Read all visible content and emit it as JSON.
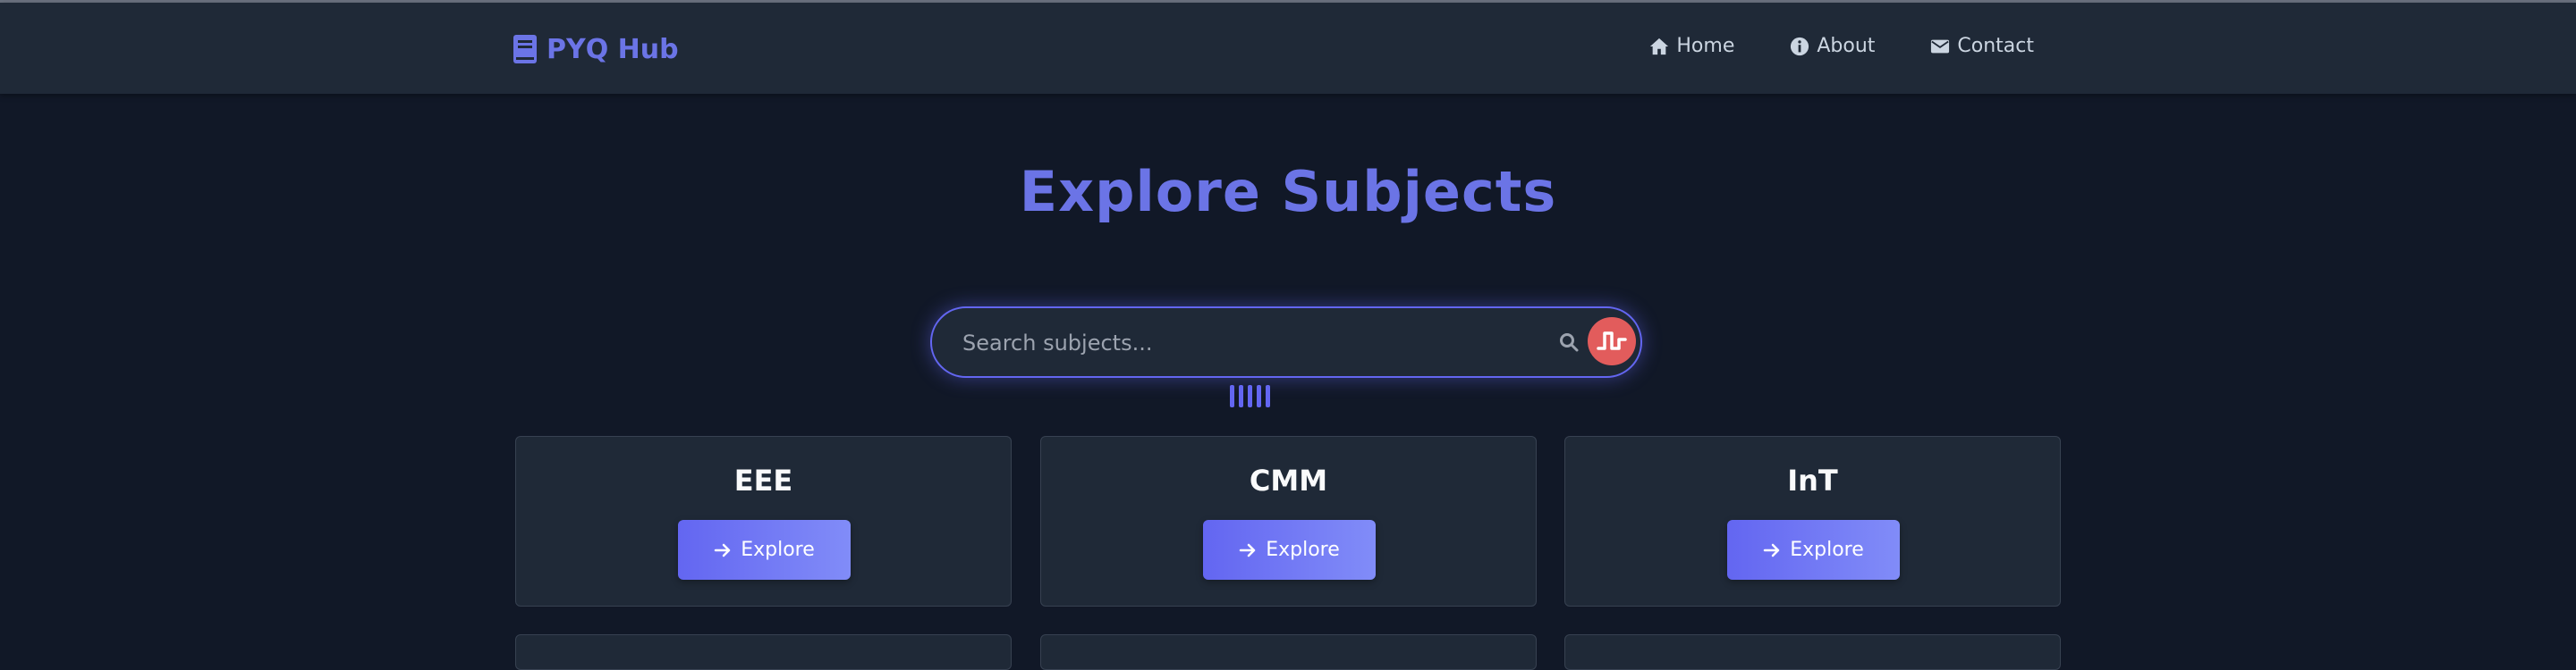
{
  "nav": {
    "brand": "PYQ Hub",
    "links": [
      {
        "label": "Home",
        "icon": "home-icon"
      },
      {
        "label": "About",
        "icon": "info-icon"
      },
      {
        "label": "Contact",
        "icon": "envelope-icon"
      }
    ]
  },
  "page": {
    "title": "Explore Subjects"
  },
  "search": {
    "placeholder": "Search subjects..."
  },
  "subjects": [
    {
      "name": "EEE",
      "button": "Explore"
    },
    {
      "name": "CMM",
      "button": "Explore"
    },
    {
      "name": "InT",
      "button": "Explore"
    }
  ],
  "colors": {
    "background": "#111827",
    "navbar": "#1f2937",
    "accent": "#6366f1",
    "accent_text": "#6b74e6",
    "voice_button": "#e25c5c"
  }
}
